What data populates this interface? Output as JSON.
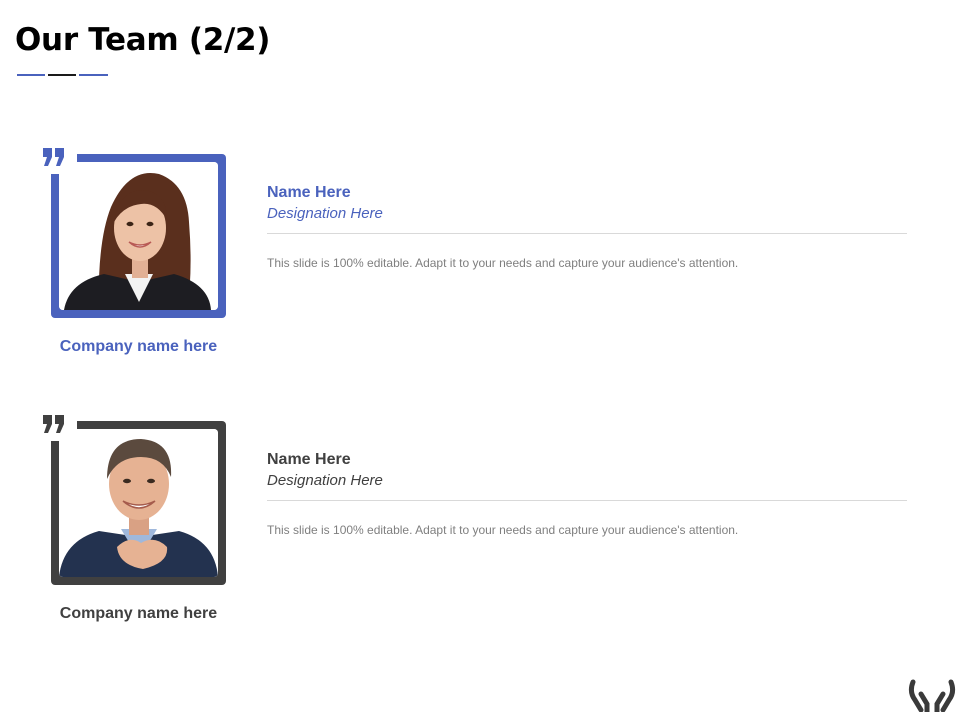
{
  "slide": {
    "title": "Our Team (2/2)"
  },
  "colors": {
    "accent": "#4a62bd",
    "dark": "#404040",
    "muted": "#7f7f7f"
  },
  "members": [
    {
      "name": "Name Here",
      "designation": "Designation Here",
      "description": "This slide is 100% editable. Adapt it to your needs and capture your audience's attention.",
      "company": "Company name here",
      "quote_icon": "quote-icon",
      "photo": "woman-portrait"
    },
    {
      "name": "Name Here",
      "designation": "Designation Here",
      "description": "This slide is 100% editable. Adapt it to your needs and capture your audience's attention.",
      "company": "Company name here",
      "quote_icon": "quote-icon",
      "photo": "man-portrait"
    }
  ],
  "decor": {
    "corner_icon": "hands-icon"
  }
}
